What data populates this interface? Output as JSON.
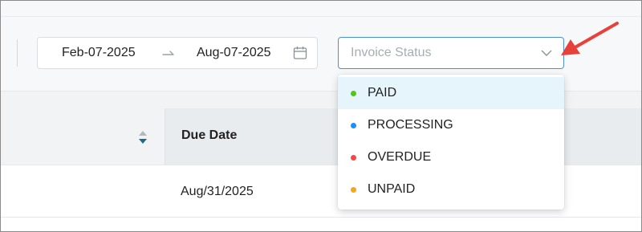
{
  "filters": {
    "date_range": {
      "start": "Feb-07-2025",
      "end": "Aug-07-2025",
      "separator_icon": "arrow-right-icon",
      "calendar_icon": "calendar-icon"
    },
    "invoice_status": {
      "placeholder": "Invoice Status",
      "icon": "chevron-down-icon",
      "is_open": true,
      "options": [
        {
          "label": "PAID",
          "color": "#52c41a",
          "highlighted": true
        },
        {
          "label": "PROCESSING",
          "color": "#1890ff",
          "highlighted": false
        },
        {
          "label": "OVERDUE",
          "color": "#f5484d",
          "highlighted": false
        },
        {
          "label": "UNPAID",
          "color": "#f0a81c",
          "highlighted": false
        }
      ]
    }
  },
  "table": {
    "columns": [
      {
        "label": "",
        "sort_icon": "sort-icon"
      },
      {
        "label": "Due Date"
      }
    ],
    "rows": [
      {
        "due_date": "Aug/31/2025"
      }
    ]
  },
  "annotation": {
    "color": "#e8413a",
    "icon": "red-arrow-icon"
  }
}
